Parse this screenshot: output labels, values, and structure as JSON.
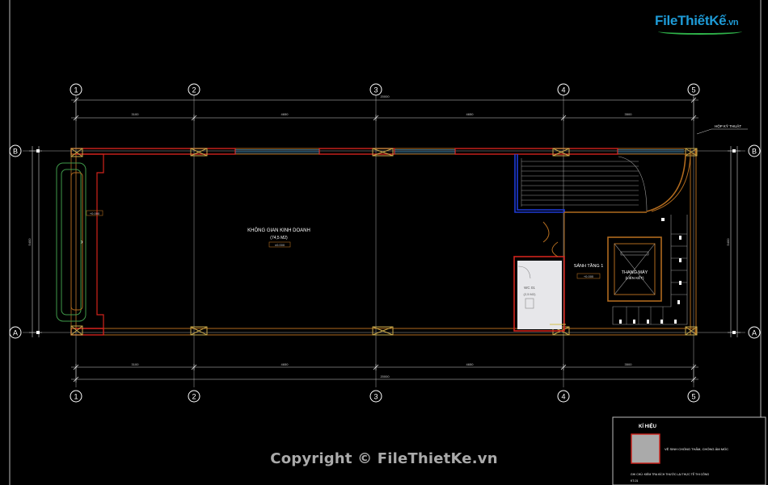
{
  "watermark": {
    "logo_text": "FileThiếtKế",
    "logo_suffix": ".vn",
    "copyright": "Copyright © FileThietKe.vn"
  },
  "grid": {
    "columns": [
      "1",
      "2",
      "3",
      "4",
      "5"
    ],
    "rows": [
      "B",
      "A"
    ]
  },
  "dimensions": {
    "top_total": "20000",
    "bottom_total": "20000",
    "top_segments": [
      "3100",
      "4650",
      "4650",
      "3500"
    ],
    "bottom_segments": [
      "3100",
      "4650",
      "4650",
      "3500"
    ],
    "left_total": "5400",
    "right_total": "5400"
  },
  "rooms": {
    "business_title": "KHÔNG GIAN KINH DOANH",
    "business_sub": "(74,5 M2)",
    "business_level": "±0.000",
    "lobby_title": "SẢNH TẦNG 1",
    "lobby_level": "+0.000",
    "elevator_title": "THANG MÁY",
    "elevator_sub": "(LIÊN KẾT)",
    "wc_title": "WC 01",
    "wc_sub": "(2,5 M2)",
    "facade_level": "+0.000",
    "gutter_label": "HỘP KỸ THUẬT"
  },
  "legend": {
    "title": "KÍ HIỆU",
    "entry": "VỆ SINH CHỐNG THẤM, CHỐNG ẨM MỐC",
    "note": "GHI CHÚ: KIỂM TRA KÍCH THƯỚC LẠI THỰC TẾ THI CÔNG",
    "sheet": "KT-01"
  },
  "colors": {
    "wall": "#b06a1e",
    "wall_red": "#d0231c",
    "column": "#c8a84a",
    "window": "#3b7fa6",
    "stair": "#1f3bd6",
    "grid_line": "#7a7a7a",
    "wc_fill": "#e7e7ea",
    "legend_swatch": "#aaaaaa",
    "swatch_border": "#d0231c"
  }
}
